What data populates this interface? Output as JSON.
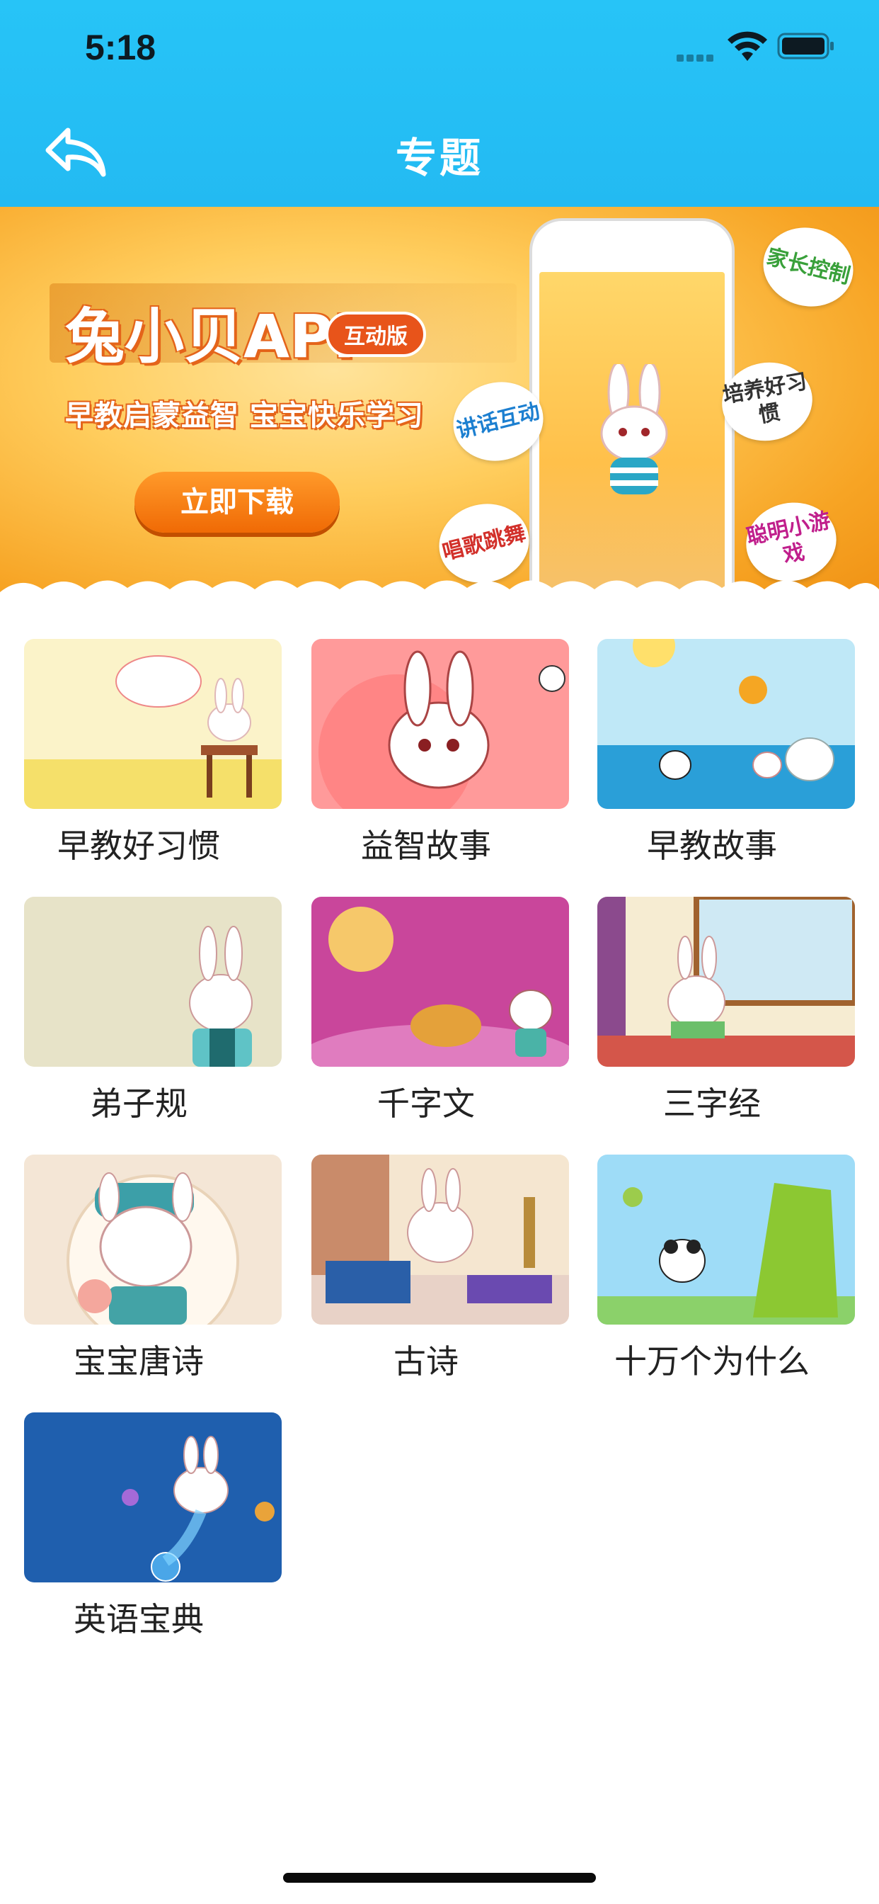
{
  "status_bar": {
    "time": "5:18"
  },
  "nav": {
    "title": "专题",
    "back_icon": "back-arrow-icon"
  },
  "banner": {
    "title": "兔小贝APP",
    "badge": "互动版",
    "tagline": "早教启蒙益智  宝宝快乐学习",
    "button": "立即下载",
    "bubbles": [
      "家长控制",
      "讲话互动",
      "培养好习惯",
      "唱歌跳舞",
      "聪明小游戏"
    ]
  },
  "topics": [
    {
      "label": "早教好习惯",
      "color": "#fbf3c9"
    },
    {
      "label": "益智故事",
      "color": "#ff9a9a"
    },
    {
      "label": "早教故事",
      "color": "#9fdcf3"
    },
    {
      "label": "弟子规",
      "color": "#e7e3c8"
    },
    {
      "label": "千字文",
      "color": "#c9469b"
    },
    {
      "label": "三字经",
      "color": "#f6ecd2"
    },
    {
      "label": "宝宝唐诗",
      "color": "#f4e6d6"
    },
    {
      "label": "古诗",
      "color": "#f5e6d0"
    },
    {
      "label": "十万个为什么",
      "color": "#9edcf7"
    },
    {
      "label": "英语宝典",
      "color": "#1f5fae"
    }
  ]
}
